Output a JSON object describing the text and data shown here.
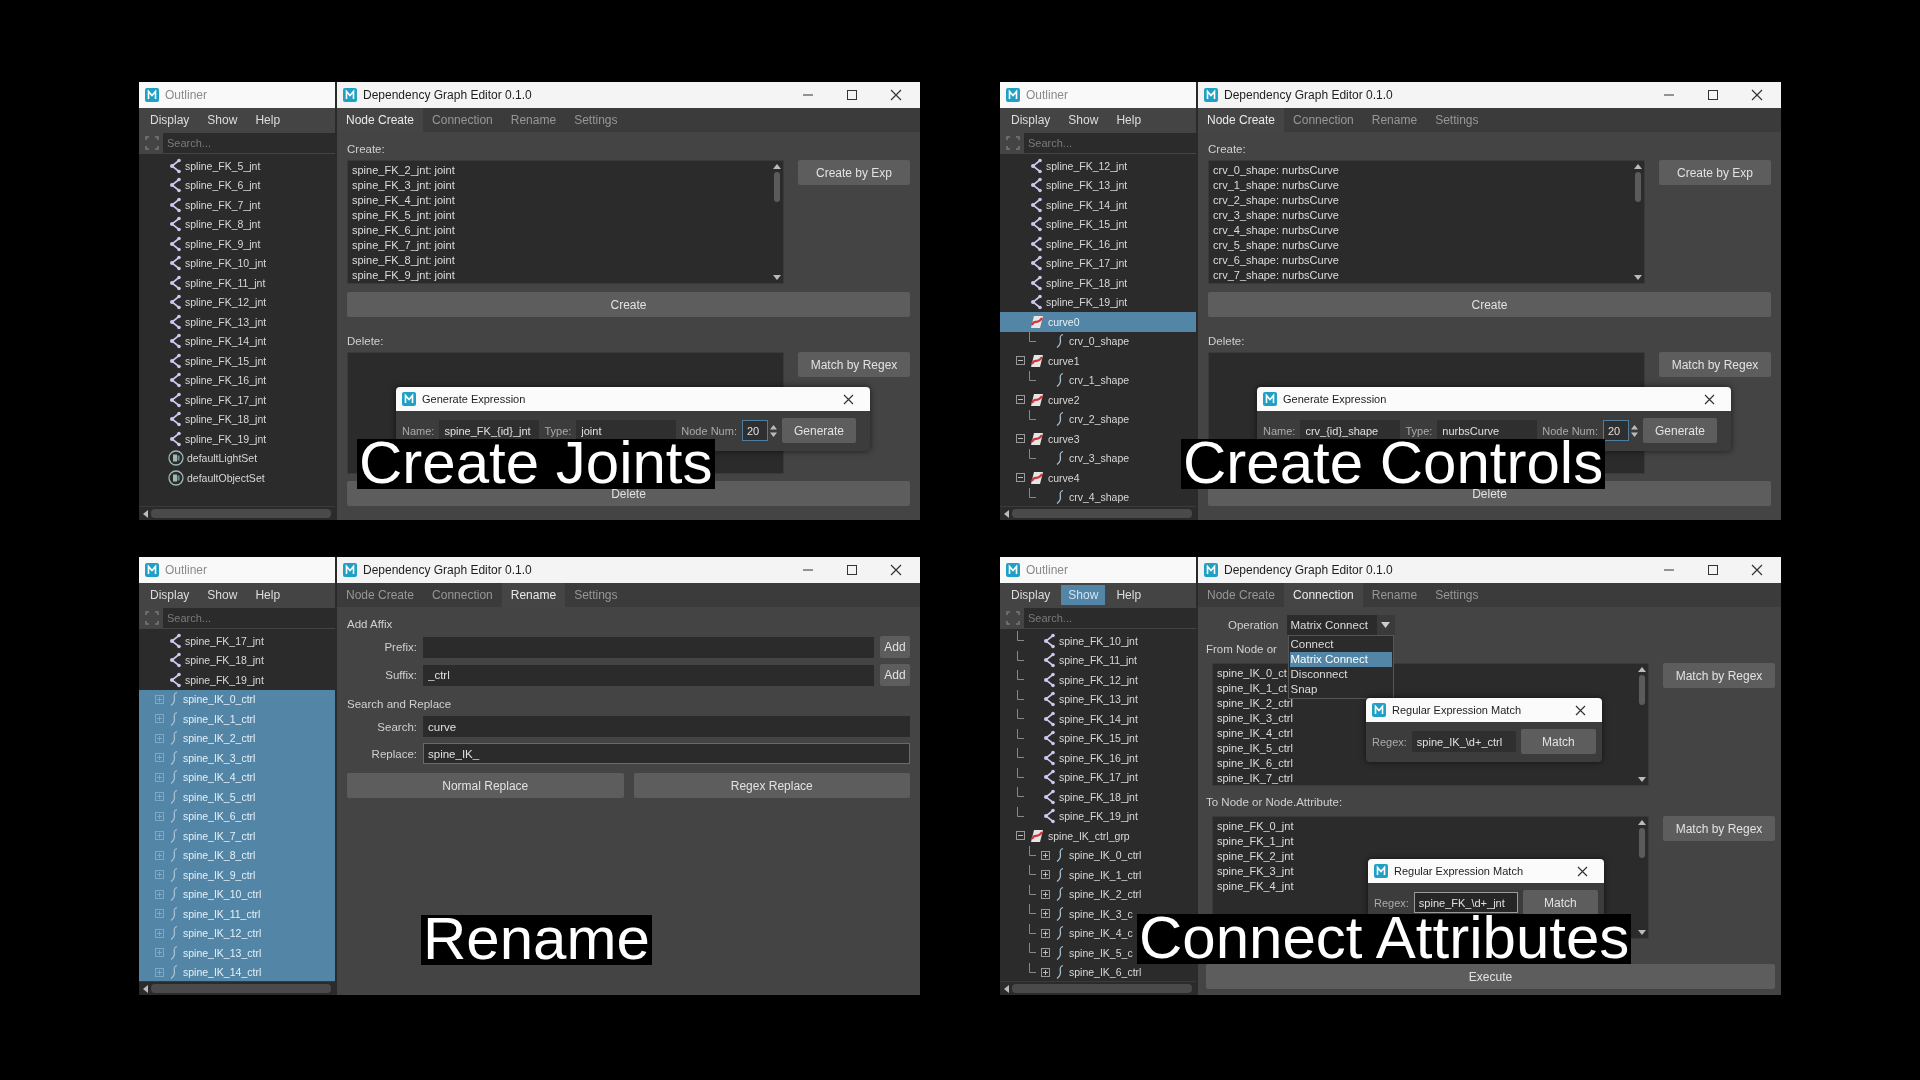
{
  "panels": [
    {
      "caption": "Create Joints",
      "outliner": {
        "title": "Outliner",
        "menu": [
          {
            "label": "Display",
            "selected": false
          },
          {
            "label": "Show",
            "selected": false
          },
          {
            "label": "Help",
            "selected": false
          }
        ],
        "search": {
          "placeholder": "Search..."
        },
        "items": [
          {
            "label": "spline_FK_5_jnt",
            "kind": "joint",
            "selected": false
          },
          {
            "label": "spline_FK_6_jnt",
            "kind": "joint",
            "selected": false
          },
          {
            "label": "spline_FK_7_jnt",
            "kind": "joint",
            "selected": false
          },
          {
            "label": "spline_FK_8_jnt",
            "kind": "joint",
            "selected": false
          },
          {
            "label": "spline_FK_9_jnt",
            "kind": "joint",
            "selected": false
          },
          {
            "label": "spline_FK_10_jnt",
            "kind": "joint",
            "selected": false
          },
          {
            "label": "spline_FK_11_jnt",
            "kind": "joint",
            "selected": false
          },
          {
            "label": "spline_FK_12_jnt",
            "kind": "joint",
            "selected": false
          },
          {
            "label": "spline_FK_13_jnt",
            "kind": "joint",
            "selected": false
          },
          {
            "label": "spline_FK_14_jnt",
            "kind": "joint",
            "selected": false
          },
          {
            "label": "spline_FK_15_jnt",
            "kind": "joint",
            "selected": false
          },
          {
            "label": "spline_FK_16_jnt",
            "kind": "joint",
            "selected": false
          },
          {
            "label": "spline_FK_17_jnt",
            "kind": "joint",
            "selected": false
          },
          {
            "label": "spline_FK_18_jnt",
            "kind": "joint",
            "selected": false
          },
          {
            "label": "spline_FK_19_jnt",
            "kind": "joint",
            "selected": false
          },
          {
            "label": "defaultLightSet",
            "kind": "set",
            "selected": false
          },
          {
            "label": "defaultObjectSet",
            "kind": "set",
            "selected": false
          }
        ]
      },
      "editor": {
        "title": "Dependency Graph Editor 0.1.0",
        "tabs": [
          {
            "label": "Node Create",
            "selected": true
          },
          {
            "label": "Connection",
            "selected": false
          },
          {
            "label": "Rename",
            "selected": false
          },
          {
            "label": "Settings",
            "selected": false
          }
        ],
        "page": {
          "kind": "node_create",
          "create_label": "Create:",
          "create_items": [
            "spine_FK_2_jnt: joint",
            "spine_FK_3_jnt: joint",
            "spine_FK_4_jnt: joint",
            "spine_FK_5_jnt: joint",
            "spine_FK_6_jnt: joint",
            "spine_FK_7_jnt: joint",
            "spine_FK_8_jnt: joint",
            "spine_FK_9_jnt: joint"
          ],
          "create_by_exp_button": "Create by Exp",
          "create_button": "Create",
          "delete_label": "Delete:",
          "match_button": "Match by Regex",
          "delete_button": "Delete"
        }
      },
      "dialogs": [
        {
          "kind": "generate",
          "title": "Generate Expression",
          "fields": [
            {
              "label": "Name:",
              "value": "spine_FK_{id}_jnt",
              "kind": "text"
            },
            {
              "label": "Type:",
              "value": "joint",
              "kind": "text"
            },
            {
              "label": "Node Num:",
              "value": "20",
              "kind": "spin"
            }
          ],
          "button": "Generate"
        }
      ]
    },
    {
      "caption": "Create Controls",
      "outliner": {
        "title": "Outliner",
        "menu": [
          {
            "label": "Display",
            "selected": false
          },
          {
            "label": "Show",
            "selected": false
          },
          {
            "label": "Help",
            "selected": false
          }
        ],
        "search": {
          "placeholder": "Search..."
        },
        "items": [
          {
            "label": "spline_FK_12_jnt",
            "kind": "joint",
            "selected": false
          },
          {
            "label": "spline_FK_13_jnt",
            "kind": "joint",
            "selected": false
          },
          {
            "label": "spline_FK_14_jnt",
            "kind": "joint",
            "selected": false
          },
          {
            "label": "spline_FK_15_jnt",
            "kind": "joint",
            "selected": false
          },
          {
            "label": "spline_FK_16_jnt",
            "kind": "joint",
            "selected": false
          },
          {
            "label": "spline_FK_17_jnt",
            "kind": "joint",
            "selected": false
          },
          {
            "label": "spline_FK_18_jnt",
            "kind": "joint",
            "selected": false
          },
          {
            "label": "spline_FK_19_jnt",
            "kind": "joint",
            "selected": false
          },
          {
            "label": "curve0",
            "kind": "curve",
            "selected": true,
            "children": [
              {
                "label": "crv_0_shape",
                "kind": "curve_shape",
                "selected": false
              }
            ]
          },
          {
            "label": "curve1",
            "kind": "curve",
            "selected": false,
            "expanded": true,
            "children": [
              {
                "label": "crv_1_shape",
                "kind": "curve_shape",
                "selected": false
              }
            ]
          },
          {
            "label": "curve2",
            "kind": "curve",
            "selected": false,
            "expanded": true,
            "children": [
              {
                "label": "crv_2_shape",
                "kind": "curve_shape",
                "selected": false
              }
            ]
          },
          {
            "label": "curve3",
            "kind": "curve",
            "selected": false,
            "expanded": true,
            "children": [
              {
                "label": "crv_3_shape",
                "kind": "curve_shape",
                "selected": false
              }
            ]
          },
          {
            "label": "curve4",
            "kind": "curve",
            "selected": false,
            "expanded": true,
            "children": [
              {
                "label": "crv_4_shape",
                "kind": "curve_shape",
                "selected": false
              }
            ]
          }
        ]
      },
      "editor": {
        "title": "Dependency Graph Editor 0.1.0",
        "tabs": [
          {
            "label": "Node Create",
            "selected": true
          },
          {
            "label": "Connection",
            "selected": false
          },
          {
            "label": "Rename",
            "selected": false
          },
          {
            "label": "Settings",
            "selected": false
          }
        ],
        "page": {
          "kind": "node_create",
          "create_label": "Create:",
          "create_items": [
            "crv_0_shape: nurbsCurve",
            "crv_1_shape: nurbsCurve",
            "crv_2_shape: nurbsCurve",
            "crv_3_shape: nurbsCurve",
            "crv_4_shape: nurbsCurve",
            "crv_5_shape: nurbsCurve",
            "crv_6_shape: nurbsCurve",
            "crv_7_shape: nurbsCurve"
          ],
          "create_by_exp_button": "Create by Exp",
          "create_button": "Create",
          "delete_label": "Delete:",
          "match_button": "Match by Regex",
          "delete_button": "Delete"
        }
      },
      "dialogs": [
        {
          "kind": "generate",
          "title": "Generate Expression",
          "fields": [
            {
              "label": "Name:",
              "value": "crv_{id}_shape",
              "kind": "text"
            },
            {
              "label": "Type:",
              "value": "nurbsCurve",
              "kind": "text"
            },
            {
              "label": "Node Num:",
              "value": "20",
              "kind": "spin"
            }
          ],
          "button": "Generate"
        }
      ]
    },
    {
      "caption": "Rename",
      "outliner": {
        "title": "Outliner",
        "menu": [
          {
            "label": "Display",
            "selected": false
          },
          {
            "label": "Show",
            "selected": false
          },
          {
            "label": "Help",
            "selected": false
          }
        ],
        "search": {
          "placeholder": "Search..."
        },
        "items": [
          {
            "label": "spine_FK_17_jnt",
            "kind": "joint",
            "selected": false
          },
          {
            "label": "spine_FK_18_jnt",
            "kind": "joint",
            "selected": false
          },
          {
            "label": "spine_FK_19_jnt",
            "kind": "joint",
            "selected": false
          },
          {
            "label": "spine_IK_0_ctrl",
            "kind": "curve_shape",
            "selected": true,
            "expanded": false
          },
          {
            "label": "spine_IK_1_ctrl",
            "kind": "curve_shape",
            "selected": true,
            "expanded": false
          },
          {
            "label": "spine_IK_2_ctrl",
            "kind": "curve_shape",
            "selected": true,
            "expanded": false
          },
          {
            "label": "spine_IK_3_ctrl",
            "kind": "curve_shape",
            "selected": true,
            "expanded": false
          },
          {
            "label": "spine_IK_4_ctrl",
            "kind": "curve_shape",
            "selected": true,
            "expanded": false
          },
          {
            "label": "spine_IK_5_ctrl",
            "kind": "curve_shape",
            "selected": true,
            "expanded": false
          },
          {
            "label": "spine_IK_6_ctrl",
            "kind": "curve_shape",
            "selected": true,
            "expanded": false
          },
          {
            "label": "spine_IK_7_ctrl",
            "kind": "curve_shape",
            "selected": true,
            "expanded": false
          },
          {
            "label": "spine_IK_8_ctrl",
            "kind": "curve_shape",
            "selected": true,
            "expanded": false
          },
          {
            "label": "spine_IK_9_ctrl",
            "kind": "curve_shape",
            "selected": true,
            "expanded": false
          },
          {
            "label": "spine_IK_10_ctrl",
            "kind": "curve_shape",
            "selected": true,
            "expanded": false
          },
          {
            "label": "spine_IK_11_ctrl",
            "kind": "curve_shape",
            "selected": true,
            "expanded": false
          },
          {
            "label": "spine_IK_12_ctrl",
            "kind": "curve_shape",
            "selected": true,
            "expanded": false
          },
          {
            "label": "spine_IK_13_ctrl",
            "kind": "curve_shape",
            "selected": true,
            "expanded": false
          },
          {
            "label": "spine_IK_14_ctrl",
            "kind": "curve_shape",
            "selected": true,
            "expanded": false
          }
        ]
      },
      "editor": {
        "title": "Dependency Graph Editor 0.1.0",
        "tabs": [
          {
            "label": "Node Create",
            "selected": false
          },
          {
            "label": "Connection",
            "selected": false
          },
          {
            "label": "Rename",
            "selected": true
          },
          {
            "label": "Settings",
            "selected": false
          }
        ],
        "page": {
          "kind": "rename",
          "affix_label": "Add Affix",
          "affix_fields": [
            {
              "label": "Prefix:",
              "button": "Add",
              "focused": false
            },
            {
              "label": "Suffix:",
              "value": "_ctrl",
              "button": "Add",
              "focused": false
            }
          ],
          "replace_label": "Search and Replace",
          "replace_fields": [
            {
              "label": "Search:",
              "value": "curve",
              "focused": false
            },
            {
              "label": "Replace:",
              "value": "spine_IK_",
              "focused": true
            }
          ],
          "buttons": [
            "Normal Replace",
            "Regex Replace"
          ]
        }
      }
    },
    {
      "caption": "Connect Attributes",
      "outliner": {
        "title": "Outliner",
        "menu": [
          {
            "label": "Display",
            "selected": false
          },
          {
            "label": "Show",
            "selected": true
          },
          {
            "label": "Help",
            "selected": false
          }
        ],
        "search": {
          "placeholder": "Search..."
        },
        "items": [
          {
            "label": "spine_FK_10_jnt",
            "kind": "joint",
            "selected": false,
            "branch": true
          },
          {
            "label": "spine_FK_11_jnt",
            "kind": "joint",
            "selected": false,
            "branch": true
          },
          {
            "label": "spine_FK_12_jnt",
            "kind": "joint",
            "selected": false,
            "branch": true
          },
          {
            "label": "spine_FK_13_jnt",
            "kind": "joint",
            "selected": false,
            "branch": true
          },
          {
            "label": "spine_FK_14_jnt",
            "kind": "joint",
            "selected": false,
            "branch": true
          },
          {
            "label": "spine_FK_15_jnt",
            "kind": "joint",
            "selected": false,
            "branch": true
          },
          {
            "label": "spine_FK_16_jnt",
            "kind": "joint",
            "selected": false,
            "branch": true
          },
          {
            "label": "spine_FK_17_jnt",
            "kind": "joint",
            "selected": false,
            "branch": true
          },
          {
            "label": "spine_FK_18_jnt",
            "kind": "joint",
            "selected": false,
            "branch": true
          },
          {
            "label": "spine_FK_19_jnt",
            "kind": "joint",
            "selected": false,
            "branch": true
          },
          {
            "label": "spine_IK_ctrl_grp",
            "kind": "curve",
            "selected": false,
            "expanded": true,
            "children": [
              {
                "label": "spine_IK_0_ctrl",
                "kind": "curve_shape",
                "selected": false,
                "expanded": false
              },
              {
                "label": "spine_IK_1_ctrl",
                "kind": "curve_shape",
                "selected": false,
                "expanded": false
              },
              {
                "label": "spine_IK_2_ctrl",
                "kind": "curve_shape",
                "selected": false,
                "expanded": false
              },
              {
                "label": "spine_IK_3_c",
                "kind": "curve_shape",
                "selected": false,
                "expanded": false
              },
              {
                "label": "spine_IK_4_c",
                "kind": "curve_shape",
                "selected": false,
                "expanded": false
              },
              {
                "label": "spine_IK_5_c",
                "kind": "curve_shape",
                "selected": false,
                "expanded": false
              },
              {
                "label": "spine_IK_6_ctrl",
                "kind": "curve_shape",
                "selected": false,
                "expanded": false
              }
            ]
          }
        ]
      },
      "editor": {
        "title": "Dependency Graph Editor 0.1.0",
        "tabs": [
          {
            "label": "Node Create",
            "selected": false
          },
          {
            "label": "Connection",
            "selected": true
          },
          {
            "label": "Rename",
            "selected": false
          },
          {
            "label": "Settings",
            "selected": false
          }
        ],
        "page": {
          "kind": "connect",
          "operation": {
            "label": "Operation",
            "value": "Matrix Connect",
            "expanded": true,
            "options": [
              {
                "label": "Connect",
                "selected": false
              },
              {
                "label": "Matrix Connect",
                "selected": true
              },
              {
                "label": "Disconnect",
                "selected": false
              },
              {
                "label": "Snap",
                "selected": false
              }
            ]
          },
          "from_label": "From Node or",
          "from_items": [
            "spine_IK_0_ct",
            "spine_IK_1_ct",
            "spine_IK_2_ctrl",
            "spine_IK_3_ctrl",
            "spine_IK_4_ctrl",
            "spine_IK_5_ctrl",
            "spine_IK_6_ctrl",
            "spine_IK_7_ctrl"
          ],
          "from_button": "Match by Regex",
          "to_label": "To Node or Node.Attribute:",
          "to_items": [
            "spine_FK_0_jnt",
            "spine_FK_1_jnt",
            "spine_FK_2_jnt",
            "spine_FK_3_jnt",
            "spine_FK_4_jnt"
          ],
          "to_button": "Match by Regex",
          "execute_button": "Execute"
        }
      },
      "dialogs": [
        {
          "kind": "regex",
          "title": "Regular Expression Match",
          "fields": [
            {
              "label": "Regex:",
              "value": "spine_IK_\\d+_ctrl",
              "kind": "text",
              "focused": false
            }
          ],
          "button": "Match"
        },
        {
          "kind": "regex",
          "title": "Regular Expression Match",
          "fields": [
            {
              "label": "Regex:",
              "value": "spine_FK_\\d+_jnt",
              "kind": "text",
              "focused": true
            }
          ],
          "button": "Match"
        }
      ]
    }
  ]
}
